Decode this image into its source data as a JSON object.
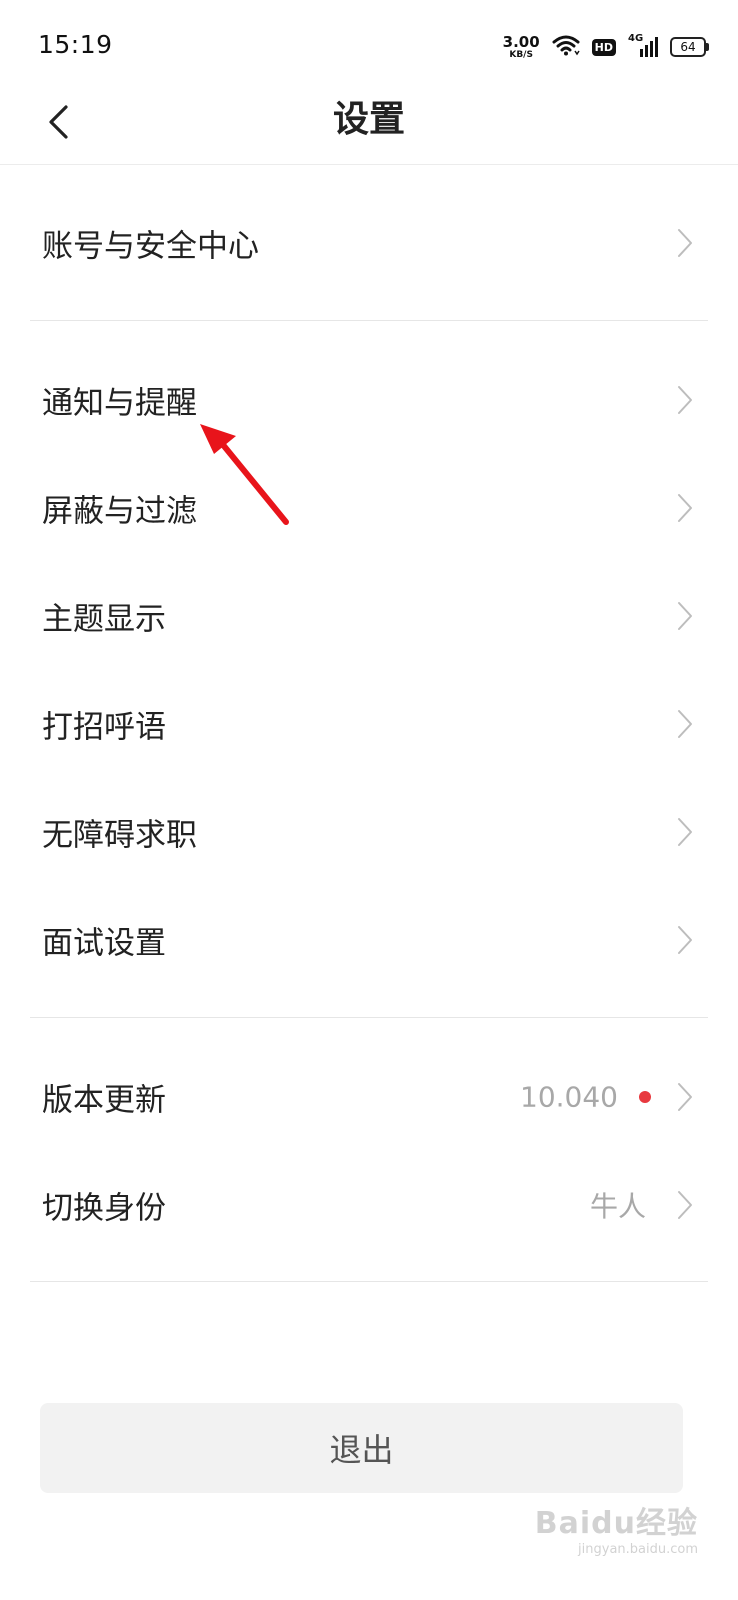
{
  "status_bar": {
    "time": "15:19",
    "net_speed_value": "3.00",
    "net_speed_unit": "KB/S",
    "hd_label": "HD",
    "network_label": "4G",
    "battery": "64",
    "icons": [
      "wifi-icon",
      "hd-icon",
      "signal-icon",
      "battery-icon"
    ]
  },
  "header": {
    "title": "设置",
    "back_icon": "chevron-left-icon"
  },
  "menu": {
    "account": {
      "label": "账号与安全中心"
    },
    "notifications": {
      "label": "通知与提醒"
    },
    "block": {
      "label": "屏蔽与过滤"
    },
    "theme": {
      "label": "主题显示"
    },
    "greeting": {
      "label": "打招呼语"
    },
    "accessibility": {
      "label": "无障碍求职"
    },
    "interview": {
      "label": "面试设置"
    },
    "update": {
      "label": "版本更新",
      "value": "10.040",
      "has_new_badge": true
    },
    "switch": {
      "label": "切换身份",
      "value": "牛人"
    }
  },
  "logout": {
    "label": "退出"
  },
  "watermark": {
    "text": "Baidu经验",
    "sub": "jingyan.baidu.com"
  },
  "colors": {
    "accent_red": "#e8393f",
    "arrow_red": "#e8141b",
    "divider": "#e6e6e6",
    "secondary_text": "#a8a8a8",
    "button_bg": "#f2f2f2"
  }
}
